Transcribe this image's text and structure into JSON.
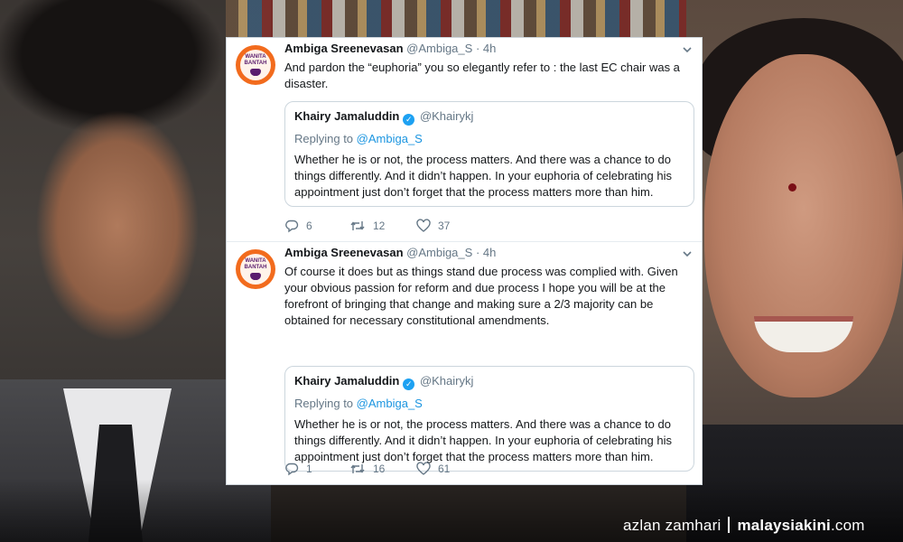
{
  "tweets": [
    {
      "author_name": "Ambiga Sreenevasan",
      "author_handle": "@Ambiga_S",
      "separator": "·",
      "time": "4h",
      "text": "And pardon the “euphoria” you so elegantly refer to : the last EC chair was a disaster.",
      "quote": {
        "author_name": "Khairy Jamaluddin",
        "author_handle": "@Khairykj",
        "replying_prefix": "Replying to",
        "replying_to": "@Ambiga_S",
        "text": "Whether he is or not, the process matters. And there was a chance to do things differently. And it didn’t happen. In your euphoria of celebrating his appointment just don’t forget that the process matters more than him."
      },
      "replies": "6",
      "retweets": "12",
      "likes": "37"
    },
    {
      "author_name": "Ambiga Sreenevasan",
      "author_handle": "@Ambiga_S",
      "separator": "·",
      "time": "4h",
      "text": "Of course it does but as things stand due process was complied with. Given your obvious passion for reform and due process I hope you will be at the forefront of bringing that change and making sure a 2/3 majority can be obtained for necessary constitutional amendments.",
      "quote": {
        "author_name": "Khairy Jamaluddin",
        "author_handle": "@Khairykj",
        "replying_prefix": "Replying to",
        "replying_to": "@Ambiga_S",
        "text": "Whether he is or not, the process matters. And there was a chance to do things differently. And it didn’t happen. In your euphoria of celebrating his appointment just don’t forget that the process matters more than him."
      },
      "replies": "1",
      "retweets": "16",
      "likes": "61"
    }
  ],
  "avatar": {
    "line1": "WANITA",
    "line2": "BANTAH"
  },
  "icons": {
    "verified": "verified-badge-icon",
    "chevron": "chevron-down-icon",
    "reply": "reply-icon",
    "retweet": "retweet-icon",
    "like": "heart-icon"
  },
  "credit": {
    "photographer": "azlan zamhari",
    "brand": "malaysiakini",
    "brand_suffix": ".com"
  },
  "colors": {
    "link": "#1b95e0",
    "muted": "#657786",
    "verified": "#1da1f2",
    "avatar_bg": "#f26b1d"
  }
}
